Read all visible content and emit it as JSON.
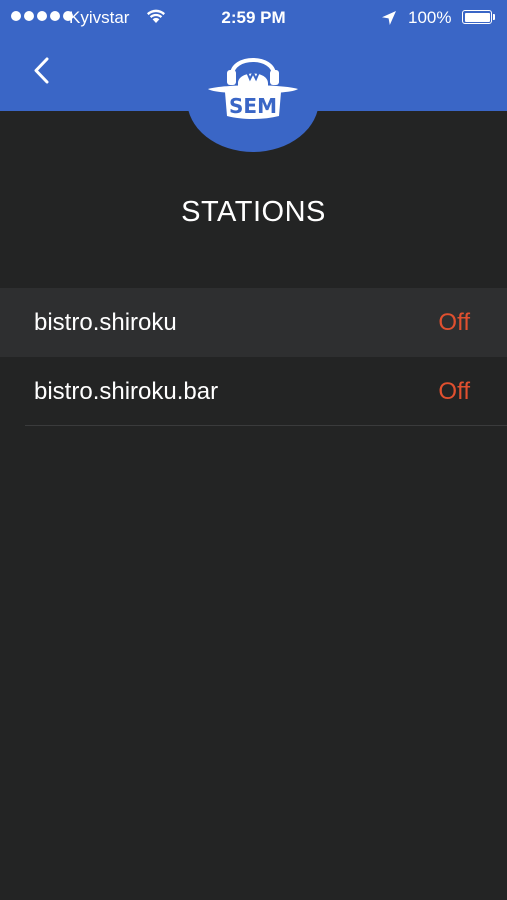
{
  "status_bar": {
    "carrier": "Kyivstar",
    "time": "2:59 PM",
    "battery": "100%",
    "battery_level": 1.0
  },
  "header": {
    "back_icon": "chevron-left-icon",
    "logo_text": "SEM",
    "brand_color": "#3a66c6"
  },
  "page": {
    "title": "STATIONS"
  },
  "stations": [
    {
      "name": "bistro.shiroku",
      "status": "Off",
      "selected": true
    },
    {
      "name": "bistro.shiroku.bar",
      "status": "Off",
      "selected": false
    }
  ],
  "colors": {
    "background": "#232424",
    "selected_row": "#2e2f30",
    "status_off": "#e0502f"
  }
}
